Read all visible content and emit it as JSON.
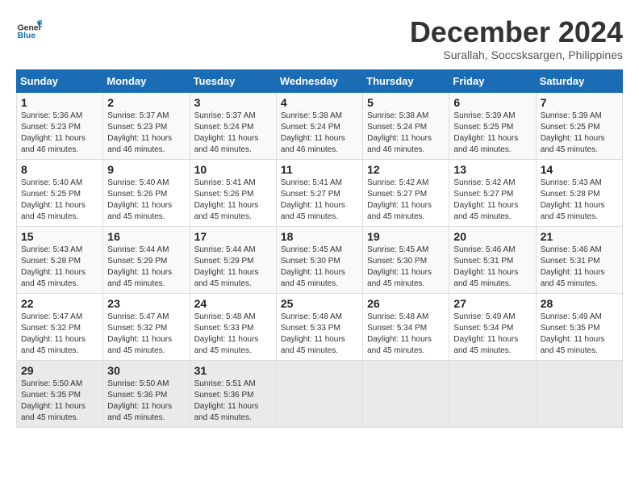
{
  "logo": {
    "line1": "General",
    "line2": "Blue"
  },
  "title": "December 2024",
  "subtitle": "Surallah, Soccsksargen, Philippines",
  "days_header": [
    "Sunday",
    "Monday",
    "Tuesday",
    "Wednesday",
    "Thursday",
    "Friday",
    "Saturday"
  ],
  "weeks": [
    [
      {
        "day": "1",
        "sunrise": "Sunrise: 5:36 AM",
        "sunset": "Sunset: 5:23 PM",
        "daylight": "Daylight: 11 hours and 46 minutes."
      },
      {
        "day": "2",
        "sunrise": "Sunrise: 5:37 AM",
        "sunset": "Sunset: 5:23 PM",
        "daylight": "Daylight: 11 hours and 46 minutes."
      },
      {
        "day": "3",
        "sunrise": "Sunrise: 5:37 AM",
        "sunset": "Sunset: 5:24 PM",
        "daylight": "Daylight: 11 hours and 46 minutes."
      },
      {
        "day": "4",
        "sunrise": "Sunrise: 5:38 AM",
        "sunset": "Sunset: 5:24 PM",
        "daylight": "Daylight: 11 hours and 46 minutes."
      },
      {
        "day": "5",
        "sunrise": "Sunrise: 5:38 AM",
        "sunset": "Sunset: 5:24 PM",
        "daylight": "Daylight: 11 hours and 46 minutes."
      },
      {
        "day": "6",
        "sunrise": "Sunrise: 5:39 AM",
        "sunset": "Sunset: 5:25 PM",
        "daylight": "Daylight: 11 hours and 46 minutes."
      },
      {
        "day": "7",
        "sunrise": "Sunrise: 5:39 AM",
        "sunset": "Sunset: 5:25 PM",
        "daylight": "Daylight: 11 hours and 45 minutes."
      }
    ],
    [
      {
        "day": "8",
        "sunrise": "Sunrise: 5:40 AM",
        "sunset": "Sunset: 5:25 PM",
        "daylight": "Daylight: 11 hours and 45 minutes."
      },
      {
        "day": "9",
        "sunrise": "Sunrise: 5:40 AM",
        "sunset": "Sunset: 5:26 PM",
        "daylight": "Daylight: 11 hours and 45 minutes."
      },
      {
        "day": "10",
        "sunrise": "Sunrise: 5:41 AM",
        "sunset": "Sunset: 5:26 PM",
        "daylight": "Daylight: 11 hours and 45 minutes."
      },
      {
        "day": "11",
        "sunrise": "Sunrise: 5:41 AM",
        "sunset": "Sunset: 5:27 PM",
        "daylight": "Daylight: 11 hours and 45 minutes."
      },
      {
        "day": "12",
        "sunrise": "Sunrise: 5:42 AM",
        "sunset": "Sunset: 5:27 PM",
        "daylight": "Daylight: 11 hours and 45 minutes."
      },
      {
        "day": "13",
        "sunrise": "Sunrise: 5:42 AM",
        "sunset": "Sunset: 5:27 PM",
        "daylight": "Daylight: 11 hours and 45 minutes."
      },
      {
        "day": "14",
        "sunrise": "Sunrise: 5:43 AM",
        "sunset": "Sunset: 5:28 PM",
        "daylight": "Daylight: 11 hours and 45 minutes."
      }
    ],
    [
      {
        "day": "15",
        "sunrise": "Sunrise: 5:43 AM",
        "sunset": "Sunset: 5:28 PM",
        "daylight": "Daylight: 11 hours and 45 minutes."
      },
      {
        "day": "16",
        "sunrise": "Sunrise: 5:44 AM",
        "sunset": "Sunset: 5:29 PM",
        "daylight": "Daylight: 11 hours and 45 minutes."
      },
      {
        "day": "17",
        "sunrise": "Sunrise: 5:44 AM",
        "sunset": "Sunset: 5:29 PM",
        "daylight": "Daylight: 11 hours and 45 minutes."
      },
      {
        "day": "18",
        "sunrise": "Sunrise: 5:45 AM",
        "sunset": "Sunset: 5:30 PM",
        "daylight": "Daylight: 11 hours and 45 minutes."
      },
      {
        "day": "19",
        "sunrise": "Sunrise: 5:45 AM",
        "sunset": "Sunset: 5:30 PM",
        "daylight": "Daylight: 11 hours and 45 minutes."
      },
      {
        "day": "20",
        "sunrise": "Sunrise: 5:46 AM",
        "sunset": "Sunset: 5:31 PM",
        "daylight": "Daylight: 11 hours and 45 minutes."
      },
      {
        "day": "21",
        "sunrise": "Sunrise: 5:46 AM",
        "sunset": "Sunset: 5:31 PM",
        "daylight": "Daylight: 11 hours and 45 minutes."
      }
    ],
    [
      {
        "day": "22",
        "sunrise": "Sunrise: 5:47 AM",
        "sunset": "Sunset: 5:32 PM",
        "daylight": "Daylight: 11 hours and 45 minutes."
      },
      {
        "day": "23",
        "sunrise": "Sunrise: 5:47 AM",
        "sunset": "Sunset: 5:32 PM",
        "daylight": "Daylight: 11 hours and 45 minutes."
      },
      {
        "day": "24",
        "sunrise": "Sunrise: 5:48 AM",
        "sunset": "Sunset: 5:33 PM",
        "daylight": "Daylight: 11 hours and 45 minutes."
      },
      {
        "day": "25",
        "sunrise": "Sunrise: 5:48 AM",
        "sunset": "Sunset: 5:33 PM",
        "daylight": "Daylight: 11 hours and 45 minutes."
      },
      {
        "day": "26",
        "sunrise": "Sunrise: 5:48 AM",
        "sunset": "Sunset: 5:34 PM",
        "daylight": "Daylight: 11 hours and 45 minutes."
      },
      {
        "day": "27",
        "sunrise": "Sunrise: 5:49 AM",
        "sunset": "Sunset: 5:34 PM",
        "daylight": "Daylight: 11 hours and 45 minutes."
      },
      {
        "day": "28",
        "sunrise": "Sunrise: 5:49 AM",
        "sunset": "Sunset: 5:35 PM",
        "daylight": "Daylight: 11 hours and 45 minutes."
      }
    ],
    [
      {
        "day": "29",
        "sunrise": "Sunrise: 5:50 AM",
        "sunset": "Sunset: 5:35 PM",
        "daylight": "Daylight: 11 hours and 45 minutes."
      },
      {
        "day": "30",
        "sunrise": "Sunrise: 5:50 AM",
        "sunset": "Sunset: 5:36 PM",
        "daylight": "Daylight: 11 hours and 45 minutes."
      },
      {
        "day": "31",
        "sunrise": "Sunrise: 5:51 AM",
        "sunset": "Sunset: 5:36 PM",
        "daylight": "Daylight: 11 hours and 45 minutes."
      },
      null,
      null,
      null,
      null
    ]
  ]
}
